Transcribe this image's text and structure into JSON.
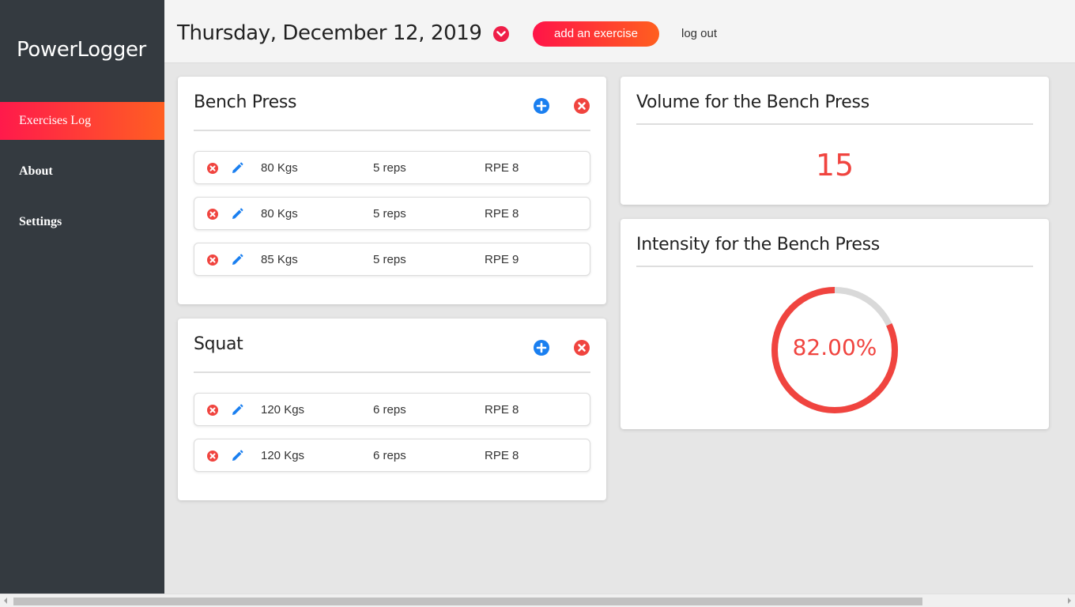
{
  "sidebar": {
    "brand": "PowerLogger",
    "items": [
      {
        "label": "Exercises Log"
      },
      {
        "label": "About"
      },
      {
        "label": "Settings"
      }
    ]
  },
  "header": {
    "date": "Thursday, December 12, 2019",
    "add_label": "add an exercise",
    "logout_label": "log out"
  },
  "exercises": [
    {
      "name": "Bench Press",
      "sets": [
        {
          "weight": "80 Kgs",
          "reps": "5 reps",
          "rpe": "RPE 8"
        },
        {
          "weight": "80 Kgs",
          "reps": "5 reps",
          "rpe": "RPE 8"
        },
        {
          "weight": "85 Kgs",
          "reps": "5 reps",
          "rpe": "RPE 9"
        }
      ]
    },
    {
      "name": "Squat",
      "sets": [
        {
          "weight": "120 Kgs",
          "reps": "6 reps",
          "rpe": "RPE 8"
        },
        {
          "weight": "120 Kgs",
          "reps": "6 reps",
          "rpe": "RPE 8"
        }
      ]
    }
  ],
  "volume": {
    "title": "Volume for the Bench Press",
    "value": "15"
  },
  "intensity": {
    "title": "Intensity for the Bench Press",
    "label": "82.00%",
    "fraction": 0.82
  },
  "colors": {
    "accent": "#f0443f",
    "blue": "#1a7ff0",
    "sidebar": "#343a40",
    "ring_track": "#d9d9d9"
  },
  "icons": {
    "date_toggle": "chevron-down-icon",
    "add_set": "plus-circle-icon",
    "remove_exercise": "close-circle-icon",
    "delete_set": "close-circle-icon",
    "edit_set": "pencil-icon"
  }
}
